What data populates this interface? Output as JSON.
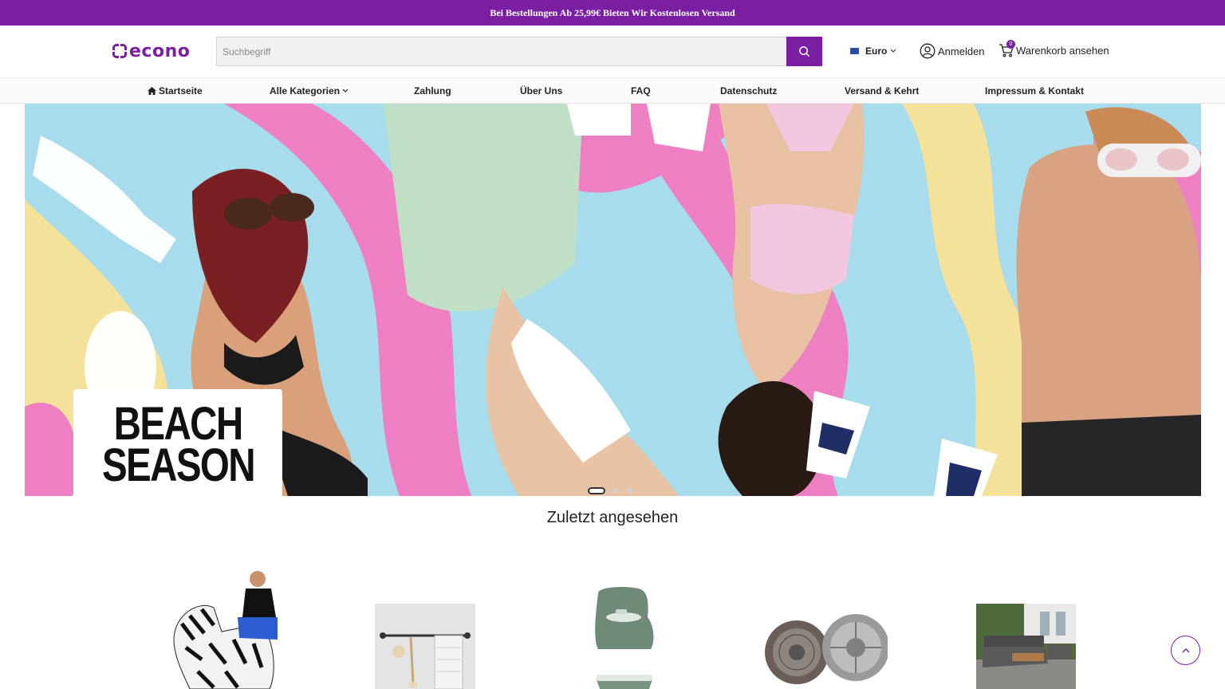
{
  "promo": {
    "text": "Bei Bestellungen Ab 25,99€ Bieten Wir Kostenlosen Versand"
  },
  "header": {
    "logo_text": "econo",
    "search_placeholder": "Suchbegriff",
    "currency_label": "Euro",
    "login_label": "Anmelden",
    "cart_label": "Warenkorb ansehen",
    "cart_count": "0"
  },
  "nav": {
    "items": [
      {
        "label": "Startseite",
        "icon": "home-icon"
      },
      {
        "label": "Alle Kategorien",
        "icon": "chevron-down-icon"
      },
      {
        "label": "Zahlung"
      },
      {
        "label": "Über Uns"
      },
      {
        "label": "FAQ"
      },
      {
        "label": "Datenschutz"
      },
      {
        "label": "Versand & Kehrt"
      },
      {
        "label": "Impressum & Kontakt"
      }
    ]
  },
  "hero": {
    "slide_text_line1": "BEACH",
    "slide_text_line2": "SEASON",
    "slides_count": 3,
    "active_slide": 1
  },
  "recent": {
    "title": "Zuletzt angesehen",
    "products": [
      {
        "image": "inflatable-zebra-costume"
      },
      {
        "image": "towel-rack"
      },
      {
        "image": "baby-potty"
      },
      {
        "image": "clutch-kit"
      },
      {
        "image": "garden-lounge-set"
      }
    ]
  },
  "colors": {
    "brand": "#7b1fa2"
  }
}
